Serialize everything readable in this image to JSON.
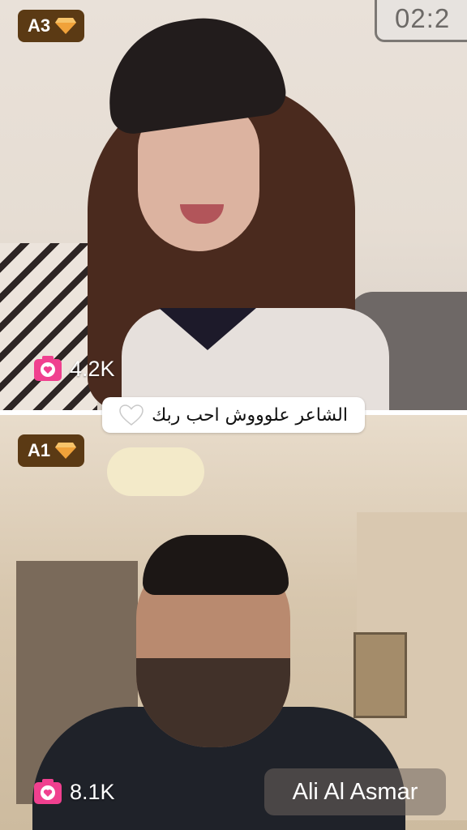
{
  "streams": {
    "top": {
      "rank": "A3",
      "viewers": "4.2K",
      "timer": "02:2"
    },
    "bottom": {
      "rank": "A1",
      "viewers": "8.1K",
      "name": "Ali Al Asmar"
    }
  },
  "comment": {
    "text": "الشاعر علوووش احب ربك",
    "icon": "white-heart-icon"
  },
  "colors": {
    "badge_bg": "#5b3a14",
    "gem": "#f0a23a",
    "camera": "#f0408f"
  }
}
